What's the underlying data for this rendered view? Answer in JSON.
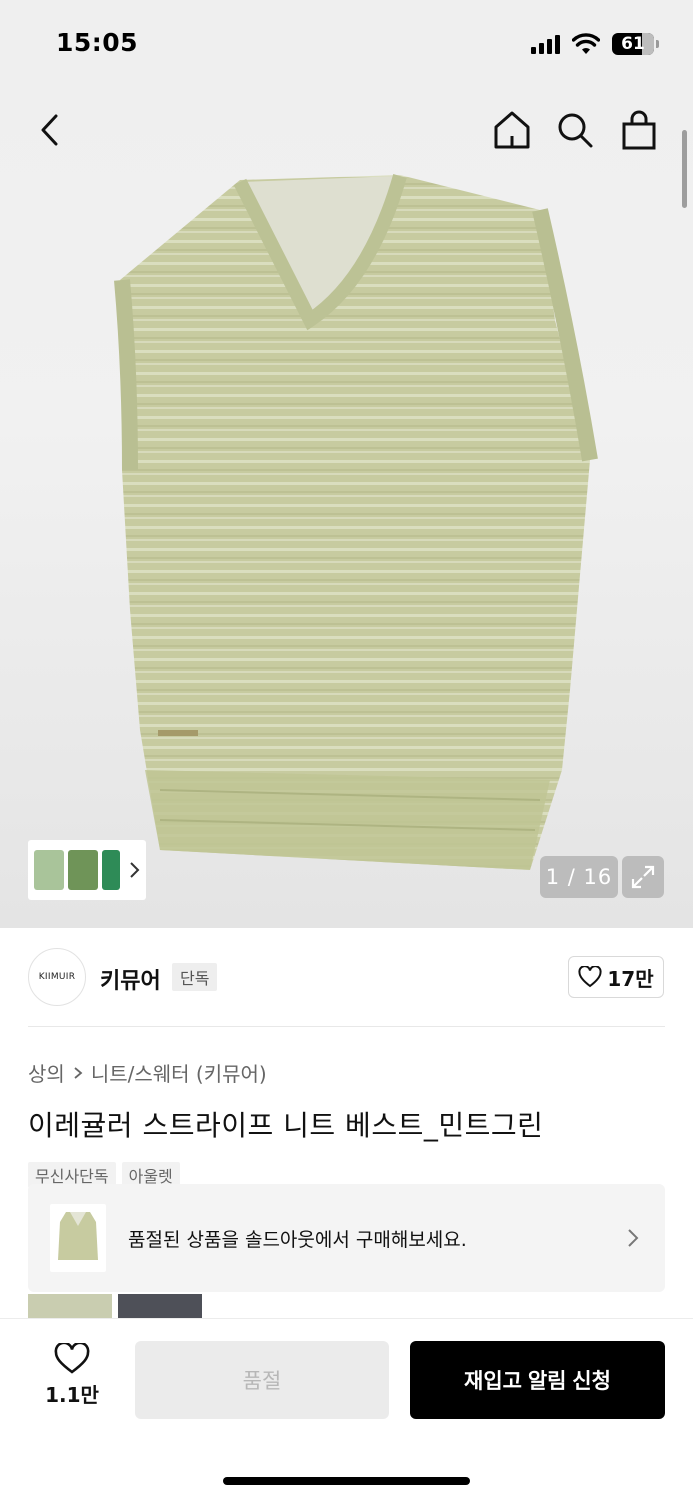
{
  "status_bar": {
    "time": "15:05",
    "battery": "61",
    "icons": [
      "cellular-signal-icon",
      "wifi-icon",
      "battery-icon"
    ]
  },
  "nav": {
    "icons": [
      "back-chevron-icon",
      "home-icon",
      "search-icon",
      "shopping-bag-icon"
    ]
  },
  "gallery": {
    "pager": "1 / 16",
    "thumb_colors": [
      "#a9c49a",
      "#6f9458",
      "#2e8b57"
    ],
    "icons": [
      "chevron-right-icon",
      "expand-icon"
    ]
  },
  "brand": {
    "logo_text": "KIIMUIR",
    "name": "키뮤어",
    "badge": "단독",
    "likes": "17만"
  },
  "breadcrumb": {
    "category": "상의",
    "subcategory": "니트/스웨터 (키뮤어)"
  },
  "product": {
    "title": "이레귤러 스트라이프 니트 베스트_민트그린",
    "tags": [
      "무신사단독",
      "아울렛"
    ]
  },
  "soldout_banner": {
    "text": "품절된 상품을 솔드아웃에서 구매해보세요."
  },
  "bottom_bar": {
    "wish_count": "1.1만",
    "soldout_label": "품절",
    "restock_label": "재입고 알림 신청"
  },
  "colors": {
    "accent_black": "#000000",
    "vest_green": "#c6cca0",
    "disabled_gray": "#ebebeb"
  }
}
